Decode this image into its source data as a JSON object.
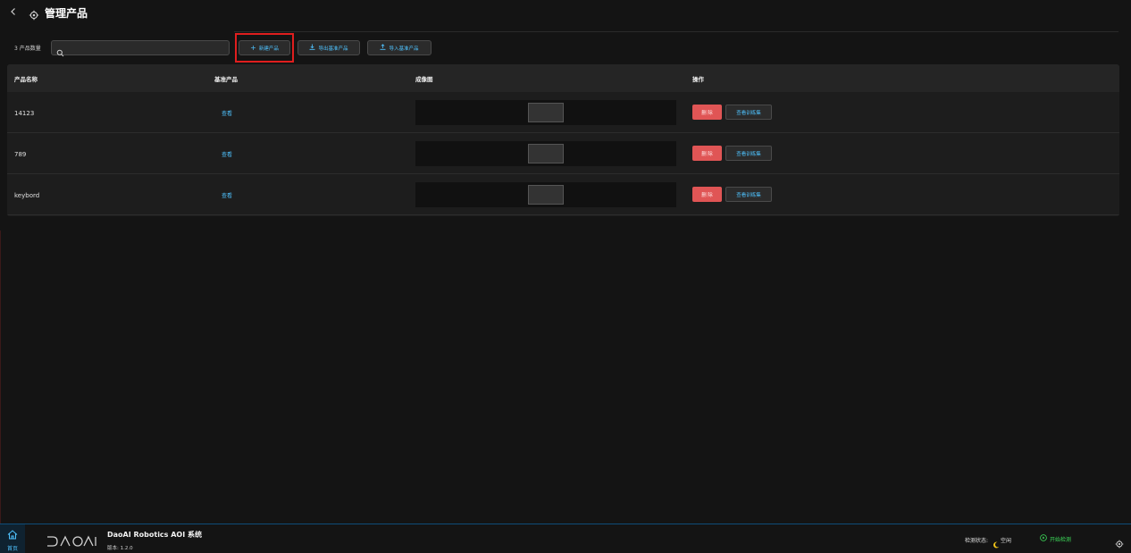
{
  "header": {
    "back_icon": "chevron-left-icon",
    "gear_icon": "gear-icon",
    "title": "管理产品"
  },
  "toolbar": {
    "count_label": "3 产品数量",
    "search_placeholder": "",
    "search_value": "",
    "new_label": "新建产品",
    "export_label": "导出基准产品",
    "import_label": "导入基准产品"
  },
  "table": {
    "columns": [
      "产品名称",
      "基准产品",
      "成像图",
      "操作"
    ],
    "rows": [
      {
        "name": "14123",
        "link": "查看",
        "delete": "删 除",
        "view": "查看训练集"
      },
      {
        "name": "789",
        "link": "查看",
        "delete": "删 除",
        "view": "查看训练集"
      },
      {
        "name": "keybord",
        "link": "查看",
        "delete": "删 除",
        "view": "查看训练集"
      }
    ]
  },
  "footer": {
    "home_label": "首页",
    "app_title": "DaoAI Robotics AOI 系统",
    "version": "版本: 1.2.0",
    "status_label": "检测状态:",
    "status_value": "空闲",
    "start_label": "开始检测"
  },
  "colors": {
    "accent": "#4fc3ff",
    "danger": "#e05555",
    "success": "#3ddc5a",
    "highlight": "#e01e1e",
    "background": "#141414"
  }
}
